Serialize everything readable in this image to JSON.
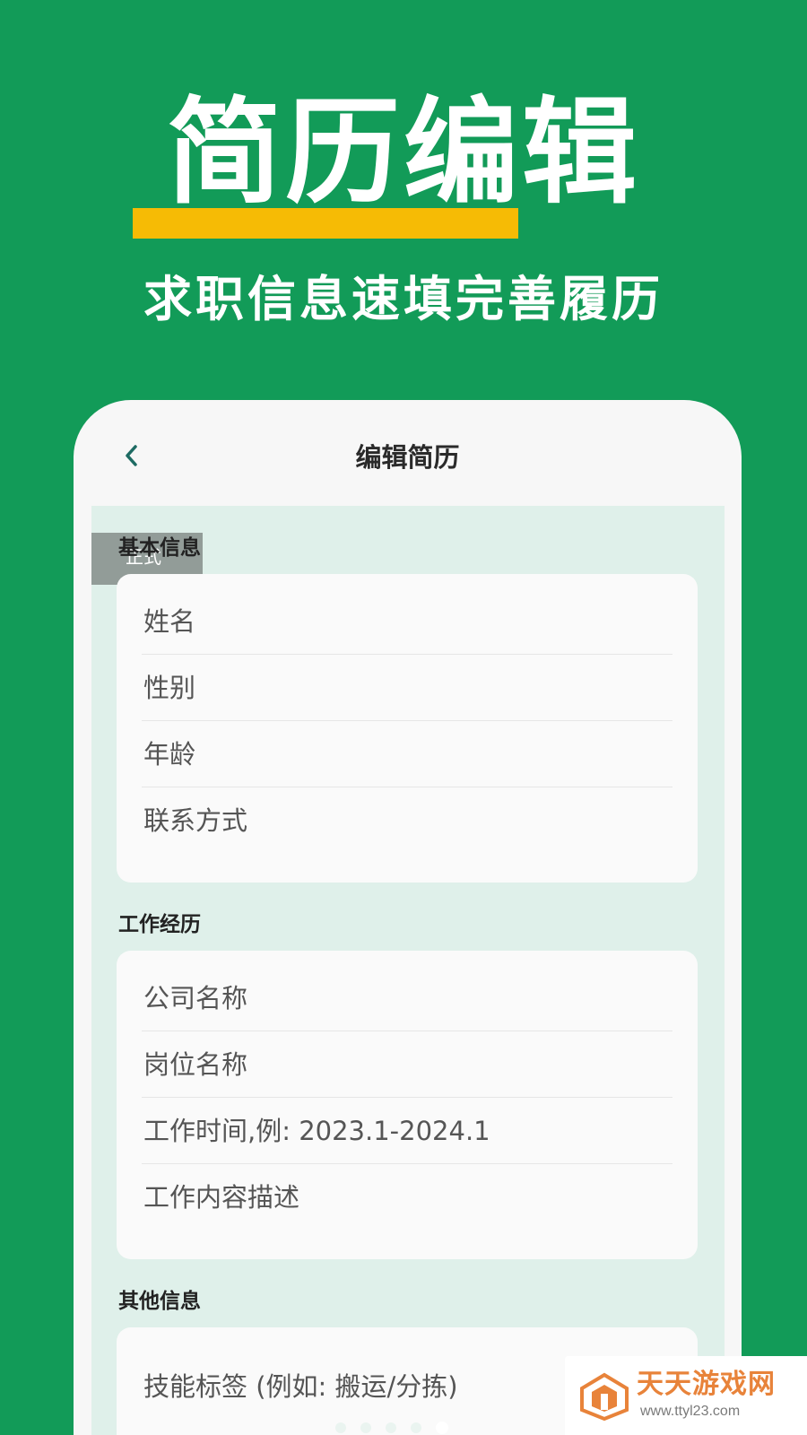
{
  "hero": {
    "title": "简历编辑",
    "subtitle": "求职信息速填完善履历"
  },
  "colors": {
    "background": "#129b58",
    "highlight": "#f6bb05",
    "content_bg": "#dff0ea",
    "accent": "#1e6b63"
  },
  "screen": {
    "nav_title": "编辑简历",
    "back_icon": "chevron-left-icon",
    "badge": "正式",
    "sections": [
      {
        "label": "基本信息",
        "fields": [
          "姓名",
          "性别",
          "年龄",
          "联系方式"
        ]
      },
      {
        "label": "工作经历",
        "fields": [
          "公司名称",
          "岗位名称",
          "工作时间,例: 2023.1-2024.1",
          "工作内容描述"
        ]
      },
      {
        "label": "其他信息",
        "fields": [
          "技能标签 (例如: 搬运/分拣)"
        ]
      }
    ],
    "carousel": {
      "total": 5,
      "active_index": 5
    }
  },
  "watermark": {
    "name": "天天游戏网",
    "url": "www.ttyl23.com"
  }
}
